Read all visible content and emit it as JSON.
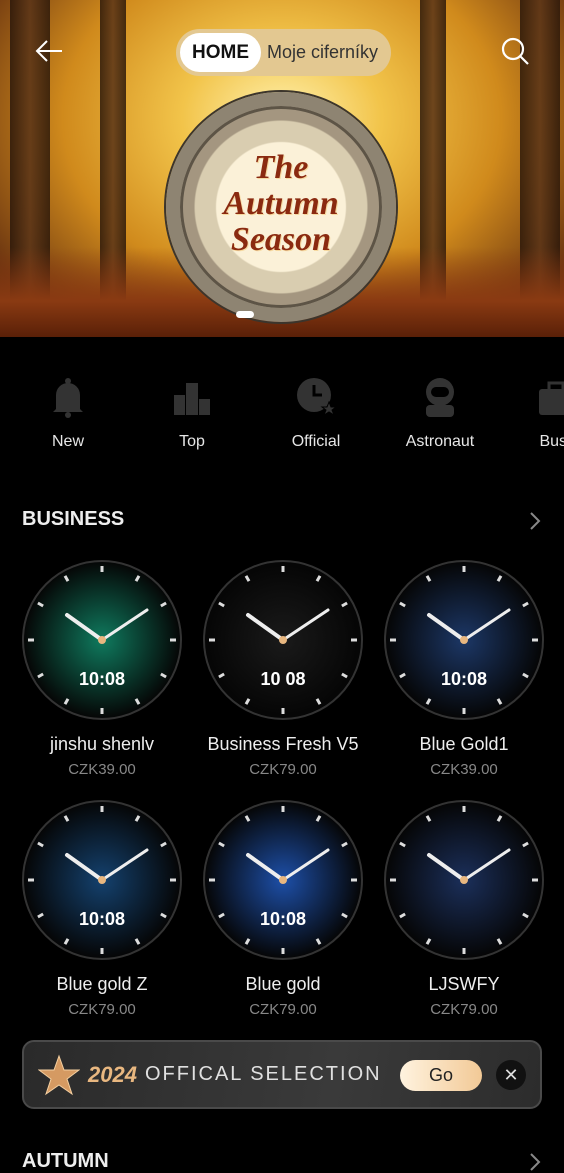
{
  "header": {
    "tabs": [
      {
        "label": "HOME",
        "active": true
      },
      {
        "label": "Moje ciferníky",
        "active": false
      }
    ],
    "back_icon": "arrow-left-icon",
    "search_icon": "search-icon"
  },
  "banner": {
    "lettering": "The Autumn Season",
    "pages": 1,
    "active_page": 1
  },
  "categories": [
    {
      "label": "New",
      "icon": "bell-icon"
    },
    {
      "label": "Top",
      "icon": "bar-chart-icon"
    },
    {
      "label": "Official",
      "icon": "clock-star-icon"
    },
    {
      "label": "Astronaut",
      "icon": "astronaut-icon"
    },
    {
      "label": "Busi",
      "icon": "briefcase-icon"
    }
  ],
  "sections": [
    {
      "title": "BUSINESS",
      "items": [
        {
          "name": "jinshu shenlv",
          "price": "CZK39.00",
          "color": "#0f7a5e",
          "time": "10:08"
        },
        {
          "name": "Business Fresh V5",
          "price": "CZK79.00",
          "color": "#1a1a1a",
          "time": "10 08"
        },
        {
          "name": "Blue Gold1",
          "price": "CZK39.00",
          "color": "#1c3766",
          "time": "10:08"
        },
        {
          "name": "Blue gold Z",
          "price": "CZK79.00",
          "color": "#14416e",
          "time": "10:08"
        },
        {
          "name": "Blue gold",
          "price": "CZK79.00",
          "color": "#1d4fa8",
          "time": "10:08"
        },
        {
          "name": "LJSWFY",
          "price": "CZK79.00",
          "color": "#1b2f5a",
          "time": ""
        }
      ]
    },
    {
      "title": "AUTUMN"
    }
  ],
  "promo": {
    "year": "2024",
    "text": "OFFICAL SELECTION",
    "go_label": "Go",
    "close": "✕",
    "accent": "#e8b780"
  }
}
